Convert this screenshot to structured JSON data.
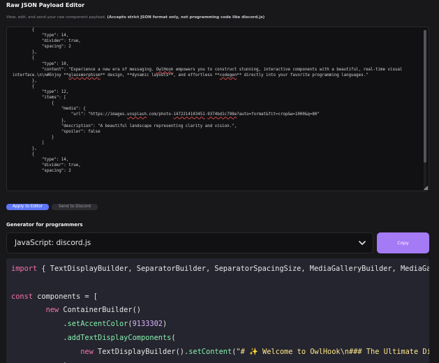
{
  "editor": {
    "title": "Raw JSON Payload Editor",
    "subtitle_plain": "View, edit, and send your raw component payload. ",
    "subtitle_bold": "(Accepts strict JSON format only, not programming code like discord.js)",
    "json_lines": [
      "        {",
      "            \"type\": 14,",
      "            \"divider\": true,",
      "            \"spacing\": 2",
      "        },",
      "        {",
      "            \"type\": 10,",
      "            \"content\": \"Experience a new era of messaging. OwlHook empowers you to construct stunning, interactive components with a beautiful, real-time visual interface.\\n\\n#Enjoy **glassmorphism** design, **dynamic layouts**, and effortless **codegen** directly into your favorite programming languages.\"",
      "        },",
      "        {",
      "            \"type\": 12,",
      "            \"items\": [",
      "                {",
      "                    \"media\": {",
      "                        \"url\": \"https://images.unsplash.com/photo-1472214103451-9374bd1c798e?auto=format&fit=crop&w=1000&q=80\"",
      "                    },",
      "                    \"description\": \"A beautiful landscape representing clarity and vision.\",",
      "                    \"spoiler\": false",
      "                }",
      "            ]",
      "        },",
      "        {",
      "            \"type\": 14,",
      "            \"divider\": true,",
      "            \"spacing\": 2"
    ],
    "apply_label": "Apply to Editor",
    "send_label": "Send to Discord"
  },
  "generator": {
    "label": "Generator for programmers",
    "selected_language": "JavaScript: discord.js",
    "copy_label": "Copy",
    "code_lines": [
      "import { TextDisplayBuilder, SeparatorBuilder, SeparatorSpacingSize, MediaGalleryBuilder, MediaGalleryItemBuilder",
      "",
      "const components = [",
      "        new ContainerBuilder()",
      "            .setAccentColor(9133302)",
      "            .addTextDisplayComponents(",
      "                new TextDisplayBuilder().setContent(\"# ✨ Welcome to OwlHook\\n### The Ultimate Discord Builder",
      "            )"
    ]
  },
  "colors": {
    "background": "#18181b",
    "apply_button": "#5e77f6",
    "copy_button": "#a57af5",
    "code_background": "#25252f"
  }
}
